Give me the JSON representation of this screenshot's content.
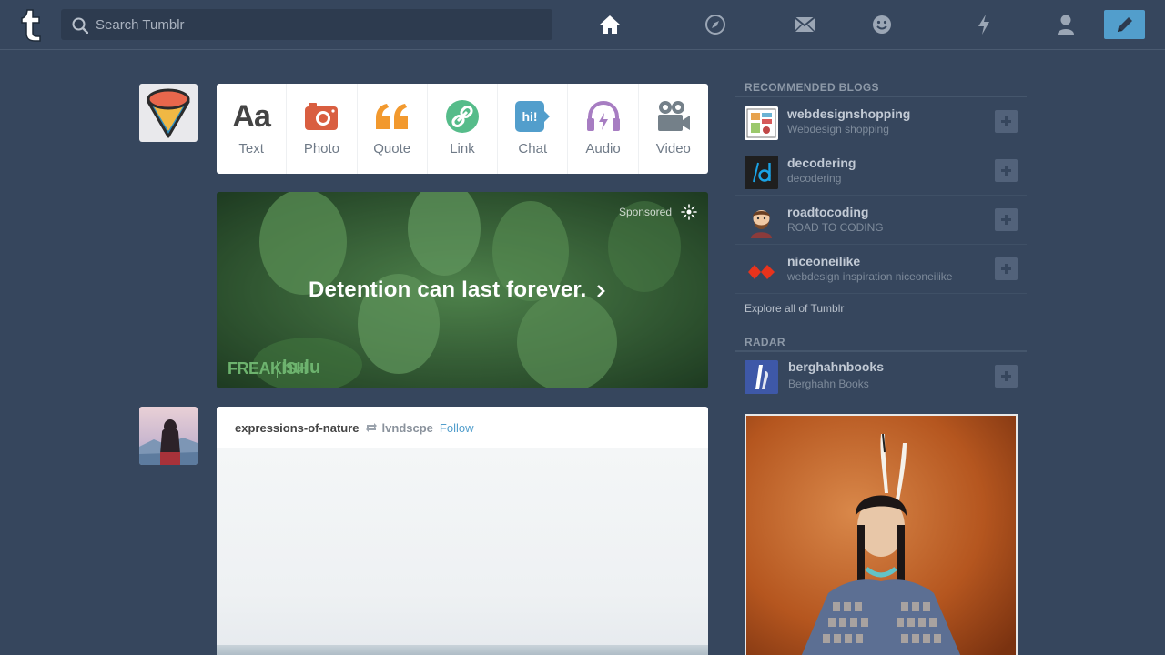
{
  "header": {
    "search_placeholder": "Search Tumblr"
  },
  "post_types": [
    {
      "label": "Text",
      "icon": "text-icon",
      "color": "#444444"
    },
    {
      "label": "Photo",
      "icon": "camera-icon",
      "color": "#d95e40"
    },
    {
      "label": "Quote",
      "icon": "quote-icon",
      "color": "#f2992e"
    },
    {
      "label": "Link",
      "icon": "link-icon",
      "color": "#56bc8a"
    },
    {
      "label": "Chat",
      "icon": "chat-icon",
      "color": "#529ecc"
    },
    {
      "label": "Audio",
      "icon": "headphones-icon",
      "color": "#a77dc2"
    },
    {
      "label": "Video",
      "icon": "video-camera-icon",
      "color": "#748089"
    }
  ],
  "ad": {
    "sponsored_label": "Sponsored",
    "headline": "Detention can last forever.",
    "brand_left": "FREAKISH",
    "brand_right": "hulu"
  },
  "post": {
    "username": "expressions-of-nature",
    "source": "lvndscpe",
    "follow_label": "Follow"
  },
  "sidebar": {
    "recommended_heading": "RECOMMENDED BLOGS",
    "recommended": [
      {
        "name": "webdesignshopping",
        "title": "Webdesign shopping"
      },
      {
        "name": "decodering",
        "title": "decodering"
      },
      {
        "name": "roadtocoding",
        "title": "ROAD TO CODING"
      },
      {
        "name": "niceoneilike",
        "title": "webdesign inspiration niceoneilike"
      }
    ],
    "explore_label": "Explore all of Tumblr",
    "radar_heading": "RADAR",
    "radar_blog": {
      "name": "berghahnbooks",
      "title": "Berghahn Books"
    }
  },
  "colors": {
    "background": "#36465d",
    "accent": "#529ecc"
  }
}
